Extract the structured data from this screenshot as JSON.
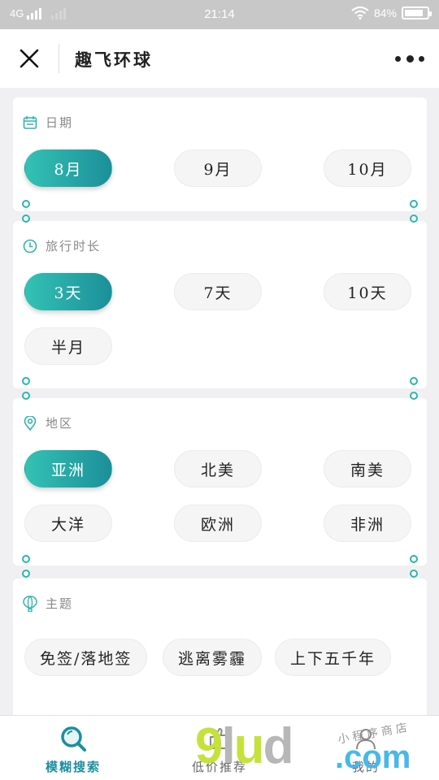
{
  "status_bar": {
    "network": "4G",
    "time": "21:14",
    "battery_text": "84%",
    "battery_level": 0.84
  },
  "header": {
    "title": "趣飞环球",
    "close_icon": "close-icon",
    "more_icon": "more-dots-icon"
  },
  "sections": {
    "date": {
      "title": "日期",
      "icon": "calendar-icon",
      "options": [
        "8月",
        "9月",
        "10月"
      ],
      "selected": "8月"
    },
    "duration": {
      "title": "旅行时长",
      "icon": "clock-icon",
      "options": [
        "3天",
        "7天",
        "10天",
        "半月"
      ],
      "selected": "3天"
    },
    "region": {
      "title": "地区",
      "icon": "location-pin-icon",
      "options": [
        "亚洲",
        "北美",
        "南美",
        "大洋",
        "欧洲",
        "非洲"
      ],
      "selected": "亚洲"
    },
    "theme": {
      "title": "主题",
      "icon": "hot-air-balloon-icon",
      "options": [
        "免签/落地签",
        "逃离雾霾",
        "上下五千年"
      ]
    }
  },
  "tabbar": {
    "tabs": [
      {
        "label": "模糊搜索",
        "icon": "search-icon",
        "active": true
      },
      {
        "label": "低价推荐",
        "icon": "thumbs-up-icon",
        "active": false
      },
      {
        "label": "我的",
        "icon": "user-icon",
        "active": false
      }
    ]
  },
  "watermark": {
    "brand": "9lud",
    "tld": ".com",
    "subtitle": "小程序商店"
  },
  "colors": {
    "accent_start": "#33c2b4",
    "accent_end": "#1c8f9a",
    "tab_active": "#1b8fa0"
  }
}
